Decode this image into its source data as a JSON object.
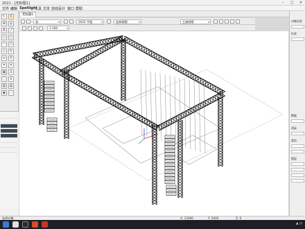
{
  "window": {
    "title": "2021 - [无标题1]",
    "min": "–",
    "max": "□",
    "close": "✕"
  },
  "menu": [
    "文件",
    "编辑",
    "Spotlight",
    "工具",
    "文本",
    "自动设计",
    "窗口",
    "帮助"
  ],
  "document_tab": "无标题1",
  "view_bar": {
    "layer_select": "无",
    "class_select": "2022 平面",
    "view_select": "右斜视图",
    "render_select": "三维线框",
    "scale_select": "1:100"
  },
  "right_panel": {
    "labels": [
      "对象信息",
      "形状",
      "数据",
      "渲染",
      "类别",
      "图层"
    ]
  },
  "status": {
    "left_text": "选择对象",
    "x": "X: 13000",
    "y": "Y: 2000",
    "z": "Z: 0"
  },
  "colors": {
    "accent": "#3b4a57",
    "truss": "#111111",
    "axis_x": "#d23b3b",
    "axis_y": "#2e9e3e",
    "axis_z": "#2f57c9"
  }
}
